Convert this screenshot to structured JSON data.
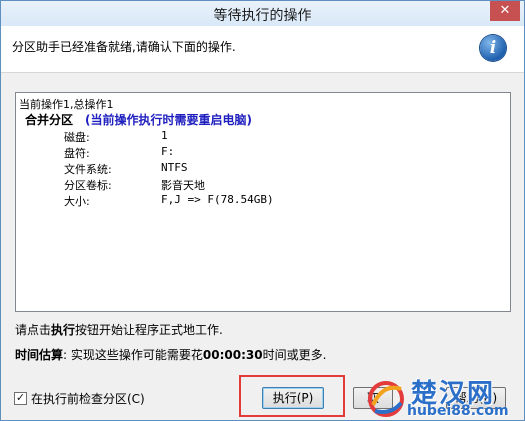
{
  "window": {
    "title": "等待执行的操作",
    "close_glyph": "✕"
  },
  "header": {
    "text": "分区助手已经准备就绪,请确认下面的操作.",
    "icon": "info-icon",
    "icon_glyph": "i"
  },
  "operations": {
    "header": "当前操作1,总操作1",
    "title": "合并分区",
    "warning": "(当前操作执行时需要重启电脑)",
    "properties": [
      {
        "label": "磁盘:",
        "value": "1"
      },
      {
        "label": "盘符:",
        "value": "F:"
      },
      {
        "label": "文件系统:",
        "value": "NTFS"
      },
      {
        "label": "分区卷标:",
        "value": "影音天地"
      },
      {
        "label": "大小:",
        "value": "F,J => F(78.54GB)"
      }
    ]
  },
  "instruction": {
    "prefix": "请点击",
    "bold": "执行",
    "suffix": "按钮开始让程序正式地工作."
  },
  "estimate": {
    "label": "时间估算",
    "text": ": 实现这些操作可能需要花",
    "time": "00:00:30",
    "suffix": "时间或更多."
  },
  "checkbox": {
    "label": "在执行前检查分区(C)",
    "checked": true,
    "mark": "✓"
  },
  "buttons": {
    "execute": "执行(P)",
    "cancel": "取",
    "help": "帮助(H)"
  },
  "watermark": {
    "text": "楚汉网",
    "url": "hubei88.com"
  },
  "colors": {
    "accent": "#2b6fc9",
    "highlight": "#e33b3b",
    "warning": "#1f1fbf"
  }
}
